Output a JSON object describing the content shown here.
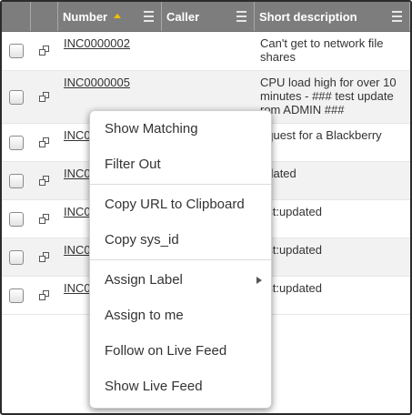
{
  "columns": {
    "number": "Number",
    "caller": "Caller",
    "description": "Short description"
  },
  "rows": [
    {
      "number": "INC0000002",
      "caller": "",
      "description": "Can't get to network file shares"
    },
    {
      "number": "INC0000005",
      "caller": "",
      "description": "CPU load high for over 10 minutes - ### test update rom ADMIN ###"
    },
    {
      "number": "INC0",
      "caller": "",
      "description": "equest for a Blackberry"
    },
    {
      "number": "INC0",
      "caller": "",
      "description": "pdated"
    },
    {
      "number": "INC0",
      "caller": "",
      "description": "est:updated"
    },
    {
      "number": "INC0",
      "caller": "",
      "description": "est:updated"
    },
    {
      "number": "INC0",
      "caller": "",
      "description": "est:updated"
    }
  ],
  "context_menu": {
    "group1": [
      "Show Matching",
      "Filter Out"
    ],
    "group2": [
      "Copy URL to Clipboard",
      "Copy sys_id"
    ],
    "group3": [
      "Assign Label",
      "Assign to me",
      "Follow on Live Feed",
      "Show Live Feed"
    ]
  },
  "colors": {
    "header_bg": "#7d7d7d",
    "sort_indicator": "#f2c200",
    "alt_row": "#f2f2f2"
  }
}
